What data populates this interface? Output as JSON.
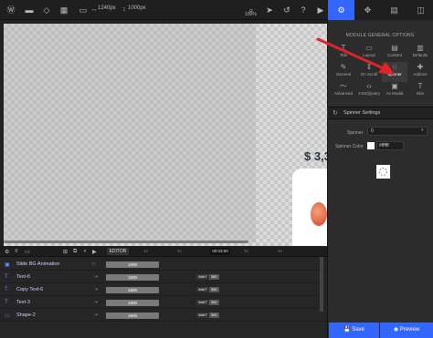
{
  "toolbar": {
    "width_label": "1240px",
    "height_label": "1000px",
    "zoom_label": "100%"
  },
  "canvas": {
    "price_text": "$ 3,3"
  },
  "timeline": {
    "editor_label": "EDITOR",
    "time_ticks": [
      "1s",
      "2s",
      "3s",
      "4s"
    ],
    "time_readout": "00:03:00",
    "rows": [
      {
        "name": "Slide BG Animation",
        "bar": "1000",
        "wait_label": "",
        "wait_val": ""
      },
      {
        "name": "Text-6",
        "bar": "1500",
        "wait_label": "WAIT",
        "wait_val": "300"
      },
      {
        "name": "Copy Text-6",
        "bar": "1500",
        "wait_label": "WAIT",
        "wait_val": "300"
      },
      {
        "name": "Text-3",
        "bar": "1500",
        "wait_label": "WAIT",
        "wait_val": "300"
      },
      {
        "name": "Shape-2",
        "bar": "1500",
        "wait_label": "WAIT",
        "wait_val": "300"
      }
    ]
  },
  "panel": {
    "section_title": "MODULE GENERAL OPTIONS",
    "options": [
      {
        "label": "Title",
        "icon": "T"
      },
      {
        "label": "Layout",
        "icon": "▭"
      },
      {
        "label": "Content",
        "icon": "▤"
      },
      {
        "label": "Defaults",
        "icon": "▥"
      },
      {
        "label": "General",
        "icon": "✎"
      },
      {
        "label": "On Scroll",
        "icon": "⇕"
      },
      {
        "label": "Spinner",
        "icon": "◌"
      },
      {
        "label": "Addons",
        "icon": "✚"
      },
      {
        "label": "Advanced",
        "icon": "〜"
      },
      {
        "label": "CSS/jQuery",
        "icon": "‹›"
      },
      {
        "label": "As Modal",
        "icon": "▣"
      },
      {
        "label": "Skin",
        "icon": "T"
      }
    ],
    "spinner_settings_title": "Spinner Settings",
    "spinner_label": "Spinner",
    "spinner_value": "0",
    "spinner_color_label": "Spinner Color",
    "spinner_color_value": "#ffffff",
    "save_label": "Save",
    "preview_label": "Preview"
  },
  "colors": {
    "accent": "#3366ff",
    "arrow": "#e0242a"
  }
}
